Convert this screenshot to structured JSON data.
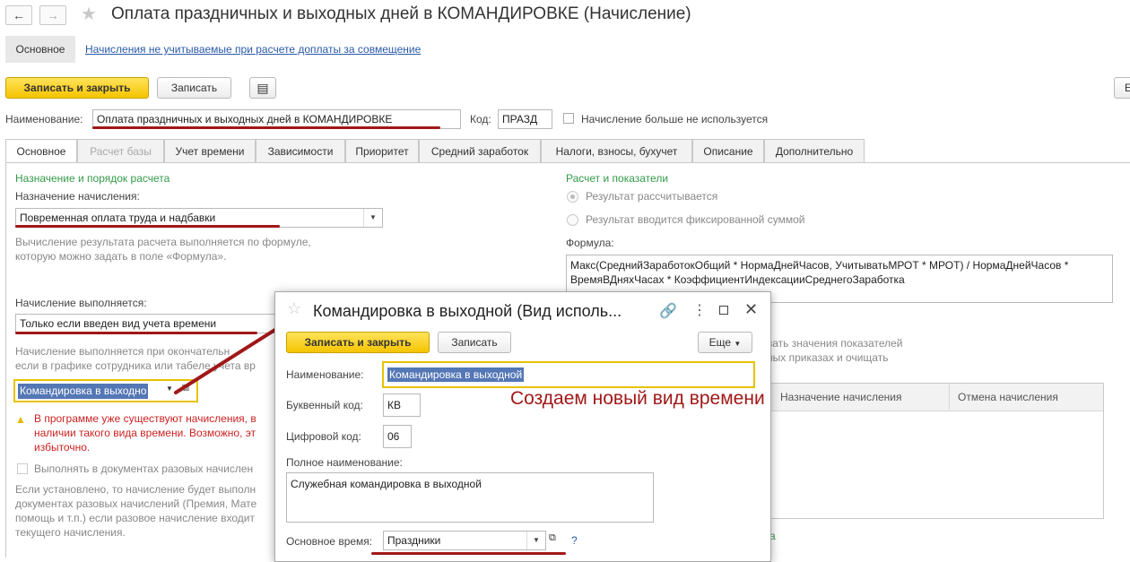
{
  "window": {
    "title": "Оплата праздничных и выходных дней в КОМАНДИРОВКЕ (Начисление)",
    "back_icon": "arrow-left-icon",
    "forward_icon": "arrow-right-icon",
    "favorite_icon": "star-icon"
  },
  "topnav": {
    "main_label": "Основное",
    "link_label": "Начисления не учитываемые при расчете доплаты за совмещение"
  },
  "toolbar": {
    "save_close_label": "Записать и закрыть",
    "save_label": "Записать",
    "doc_icon": "document-list-icon",
    "right_edge_label": "Е"
  },
  "header_fields": {
    "name_label": "Наименование:",
    "name_value": "Оплата праздничных и выходных дней в КОМАНДИРОВКЕ",
    "code_label": "Код:",
    "code_value": "ПРАЗД",
    "unused_label": "Начисление больше не используется"
  },
  "tabs": [
    {
      "label": "Основное"
    },
    {
      "label": "Расчет базы"
    },
    {
      "label": "Учет времени"
    },
    {
      "label": "Зависимости"
    },
    {
      "label": "Приоритет"
    },
    {
      "label": "Средний заработок"
    },
    {
      "label": "Налоги, взносы, бухучет"
    },
    {
      "label": "Описание"
    },
    {
      "label": "Дополнительно"
    }
  ],
  "left": {
    "section_title": "Назначение и порядок расчета",
    "purpose_label": "Назначение начисления:",
    "purpose_value": "Повременная оплата труда и надбавки",
    "hint_line1": "Вычисление результата расчета выполняется по формуле,",
    "hint_line2": "которую можно задать в поле «Формула».",
    "exec_label": "Начисление выполняется:",
    "exec_value": "Только если введен вид учета времени",
    "exec_hint1": "Начисление выполняется при окончательн",
    "exec_hint2": "если в графике сотрудника или табеле учета вр",
    "time_kind_value": "Командировка в выходно",
    "warning_line1": "В программе уже существуют начисления, в",
    "warning_line2": "наличии такого вида времени. Возможно, эт",
    "warning_line3": "избыточно.",
    "oneoff_label": "Выполнять в документах разовых начислен",
    "oneoff_hint1": "Если установлено, то начисление будет выполн",
    "oneoff_hint2": "документах разовых начислений (Премия, Мате",
    "oneoff_hint3": "помощь и т.п.) если разовое начисление входит",
    "oneoff_hint4": "текущего начисления."
  },
  "right": {
    "section_title": "Расчет и показатели",
    "radio1_label": "Результат рассчитывается",
    "radio2_label": "Результат вводится фиксированной суммой",
    "formula_label": "Формула:",
    "formula_line1": "Макс(СреднийЗаработокОбщий * НормаДнейЧасов, УчитыватьМРОТ * МРОТ) / НормаДнейЧасов *",
    "formula_line2": "ВремяВДняхЧасах * КоэффициентИндексацииСреднегоЗаработка",
    "partial1": "вать значения показателей",
    "partial2": "ных приказах и очищать",
    "table_col1": "Назначение начисления",
    "table_col2": "Отмена начисления",
    "bottom_partial": "а"
  },
  "annotation": {
    "text": "Создаем новый вид времени",
    "color": "#a01818"
  },
  "dialog": {
    "title": "Командировка в выходной (Вид исполь...",
    "link_icon": "link-icon",
    "menu_icon": "more-vertical-icon",
    "maximize_icon": "maximize-icon",
    "close_icon": "close-icon",
    "save_close_label": "Записать и закрыть",
    "save_label": "Записать",
    "more_label": "Еще",
    "name_label": "Наименование:",
    "name_value": "Командировка в выходной",
    "letter_code_label": "Буквенный код:",
    "letter_code_value": "КВ",
    "digit_code_label": "Цифровой код:",
    "digit_code_value": "06",
    "full_name_label": "Полное наименование:",
    "full_name_value": "Служебная командировка в выходной",
    "base_time_label": "Основное время:",
    "base_time_value": "Праздники",
    "help_label": "?"
  }
}
